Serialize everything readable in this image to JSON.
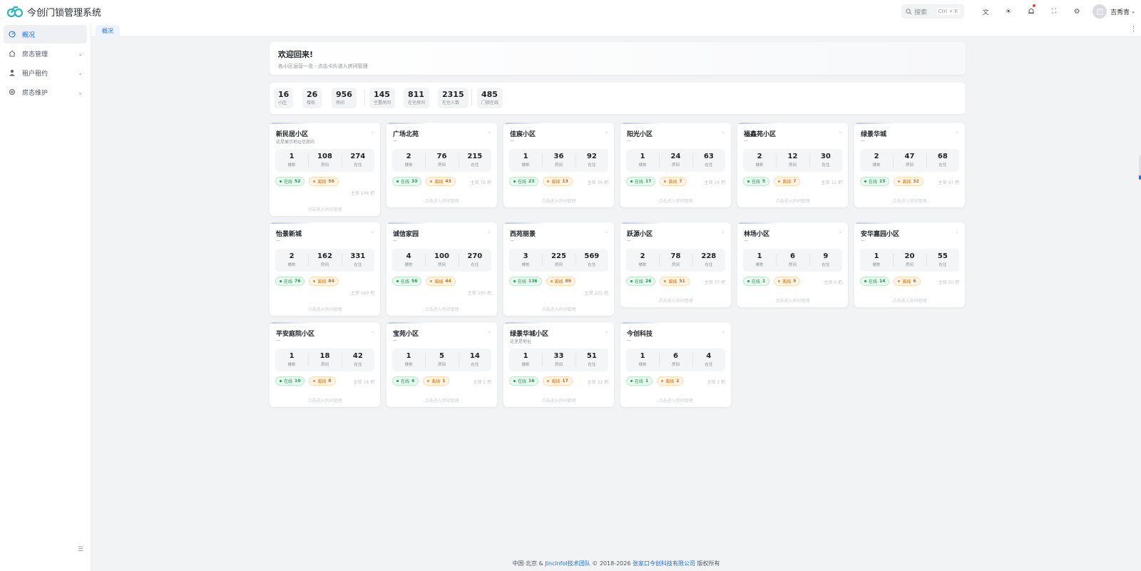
{
  "app": {
    "title": "今创门锁管理系统"
  },
  "header": {
    "search_placeholder": "搜索",
    "search_shortcut": "Ctrl + K",
    "user_name": "吉秀青"
  },
  "sidebar": {
    "items": [
      {
        "label": "概况",
        "icon": "dashboard-icon",
        "active": true
      },
      {
        "label": "房态管理",
        "icon": "home-icon"
      },
      {
        "label": "租户租约",
        "icon": "user-icon"
      },
      {
        "label": "房态维护",
        "icon": "gear-icon"
      }
    ]
  },
  "tabs": [
    {
      "label": "概况"
    }
  ],
  "welcome": {
    "title": "欢迎回来!",
    "subtitle": "各小区运营一览 · 点击卡片进入房间管理"
  },
  "stats": [
    {
      "value": "16",
      "label": "小区"
    },
    {
      "value": "26",
      "label": "楼栋"
    },
    {
      "value": "956",
      "label": "房间"
    },
    {
      "value": "145",
      "label": "空置房间"
    },
    {
      "value": "811",
      "label": "在住房间"
    },
    {
      "value": "2315",
      "label": "在住人数"
    },
    {
      "value": "485",
      "label": "门锁在线"
    }
  ],
  "card_labels": {
    "buildings": "楼栋",
    "rooms": "房间",
    "residents": "在住",
    "online": "在线",
    "offline": "离线",
    "hint": "点击进入房间管理"
  },
  "communities": [
    {
      "name": "新民居小区",
      "sub": "这是展示地址信息的",
      "buildings": "1",
      "rooms": "108",
      "residents": "274",
      "online": "52",
      "offline": "56",
      "owner": "主锁 108 把"
    },
    {
      "name": "广场北苑",
      "sub": "—",
      "buildings": "2",
      "rooms": "76",
      "residents": "215",
      "online": "33",
      "offline": "43",
      "owner": "主锁 76 把"
    },
    {
      "name": "佳宸小区",
      "sub": "—",
      "buildings": "1",
      "rooms": "36",
      "residents": "92",
      "online": "23",
      "offline": "13",
      "owner": "主锁 36 把"
    },
    {
      "name": "阳光小区",
      "sub": "—",
      "buildings": "1",
      "rooms": "24",
      "residents": "63",
      "online": "17",
      "offline": "7",
      "owner": "主锁 24 把"
    },
    {
      "name": "福鑫苑小区",
      "sub": "—",
      "buildings": "2",
      "rooms": "12",
      "residents": "30",
      "online": "5",
      "offline": "7",
      "owner": "主锁 12 把"
    },
    {
      "name": "绿景华城",
      "sub": "—",
      "buildings": "2",
      "rooms": "47",
      "residents": "68",
      "online": "15",
      "offline": "32",
      "owner": "主锁 47 把"
    },
    {
      "name": "怡景新城",
      "sub": "—",
      "buildings": "2",
      "rooms": "162",
      "residents": "331",
      "online": "76",
      "offline": "84",
      "owner": "主锁 160 把"
    },
    {
      "name": "诚信家园",
      "sub": "—",
      "buildings": "4",
      "rooms": "100",
      "residents": "270",
      "online": "56",
      "offline": "44",
      "owner": "主锁 100 把"
    },
    {
      "name": "西苑丽景",
      "sub": "—",
      "buildings": "3",
      "rooms": "225",
      "residents": "569",
      "online": "136",
      "offline": "89",
      "owner": "主锁 225 把"
    },
    {
      "name": "跃源小区",
      "sub": "—",
      "buildings": "2",
      "rooms": "78",
      "residents": "228",
      "online": "26",
      "offline": "51",
      "owner": "主锁 77 把"
    },
    {
      "name": "林场小区",
      "sub": "—",
      "buildings": "1",
      "rooms": "6",
      "residents": "9",
      "online": "1",
      "offline": "5",
      "owner": "主锁 6 把"
    },
    {
      "name": "安华嘉园小区",
      "sub": "—",
      "buildings": "1",
      "rooms": "20",
      "residents": "55",
      "online": "14",
      "offline": "6",
      "owner": "主锁 20 把"
    },
    {
      "name": "平安庭院小区",
      "sub": "—",
      "buildings": "1",
      "rooms": "18",
      "residents": "42",
      "online": "10",
      "offline": "8",
      "owner": "主锁 18 把"
    },
    {
      "name": "宝苑小区",
      "sub": "—",
      "buildings": "1",
      "rooms": "5",
      "residents": "14",
      "online": "4",
      "offline": "1",
      "owner": "主锁 5 把"
    },
    {
      "name": "绿景华城小区",
      "sub": "这里是地址",
      "buildings": "1",
      "rooms": "33",
      "residents": "51",
      "online": "16",
      "offline": "17",
      "owner": "主锁 33 把"
    },
    {
      "name": "今创科技",
      "sub": "—",
      "buildings": "1",
      "rooms": "6",
      "residents": "4",
      "online": "1",
      "offline": "2",
      "owner": "主锁 3 把"
    }
  ],
  "footer": {
    "prefix": "中国·北京 &",
    "team_link": "JinclnfoI技术团队",
    "copyright": "© 2018-2026",
    "company_link": "张家口今创科技有限公司",
    "suffix": "版权所有"
  },
  "colors": {
    "accent": "#1f6feb",
    "online": "#1f9d55",
    "offline": "#fa8c16"
  }
}
